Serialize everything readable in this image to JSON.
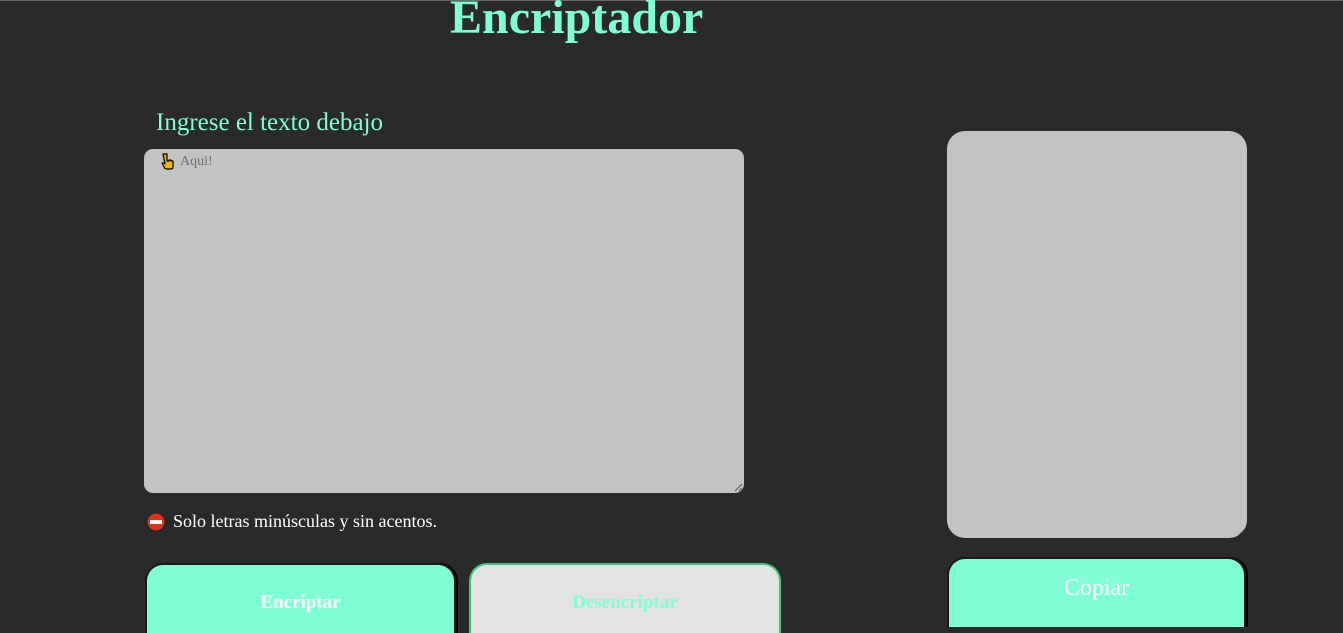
{
  "header": {
    "title": "Encriptador"
  },
  "input": {
    "label": "Ingrese el texto debajo",
    "placeholder": "Aqui!",
    "value": "",
    "hint_icon": "pointing-down-hand-icon"
  },
  "warning": {
    "icon": "no-entry-icon",
    "text": "Solo letras minúsculas y sin acentos."
  },
  "actions": {
    "encrypt_label": "Encriptar",
    "decrypt_label": "Desencriptar"
  },
  "output": {
    "value": "",
    "copy_label": "Copiar"
  },
  "colors": {
    "background": "#2a2a2a",
    "accent": "#7fffd4",
    "panel": "#c3c3c3",
    "secondary_button": "#e3e3e3",
    "text_light": "#ffffff"
  }
}
